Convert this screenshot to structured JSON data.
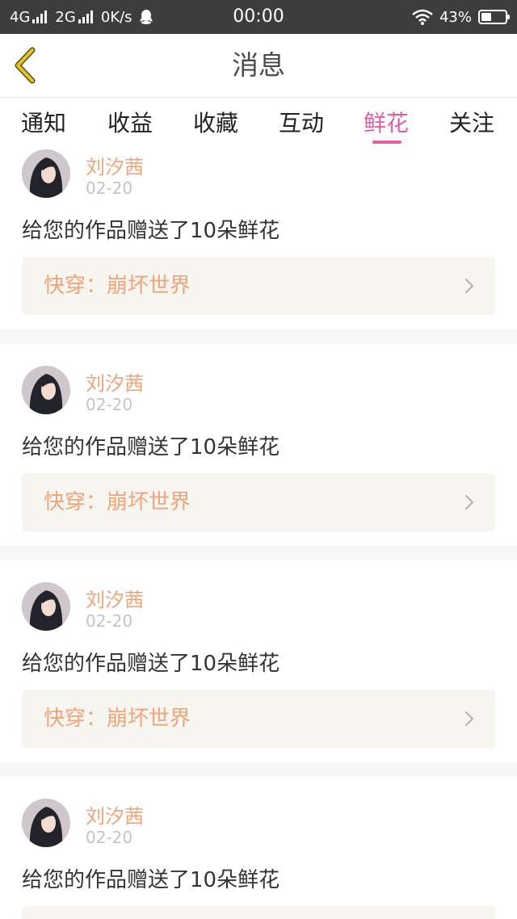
{
  "status_bar": {
    "network_1": "4G",
    "network_2": "2G",
    "speed": "0K/s",
    "time": "00:00",
    "battery_text": "43%",
    "battery_level": 0.43
  },
  "nav": {
    "title": "消息",
    "back_icon": "chevron-left-icon"
  },
  "tabs": [
    {
      "label": "通知",
      "active": false
    },
    {
      "label": "收益",
      "active": false
    },
    {
      "label": "收藏",
      "active": false
    },
    {
      "label": "互动",
      "active": false
    },
    {
      "label": "鲜花",
      "active": true
    },
    {
      "label": "关注",
      "active": false
    }
  ],
  "messages": [
    {
      "sender": "刘汐茜",
      "date": "02-20",
      "text": "给您的作品赠送了10朵鲜花",
      "work": "快穿：崩坏世界"
    },
    {
      "sender": "刘汐茜",
      "date": "02-20",
      "text": "给您的作品赠送了10朵鲜花",
      "work": "快穿：崩坏世界"
    },
    {
      "sender": "刘汐茜",
      "date": "02-20",
      "text": "给您的作品赠送了10朵鲜花",
      "work": "快穿：崩坏世界"
    },
    {
      "sender": "刘汐茜",
      "date": "02-20",
      "text": "给您的作品赠送了10朵鲜花"
    }
  ],
  "colors": {
    "accent": "#e05ea2",
    "sender": "#f0a47a",
    "back_icon": "#e8c22a",
    "work_bg": "#f6f5ef"
  }
}
